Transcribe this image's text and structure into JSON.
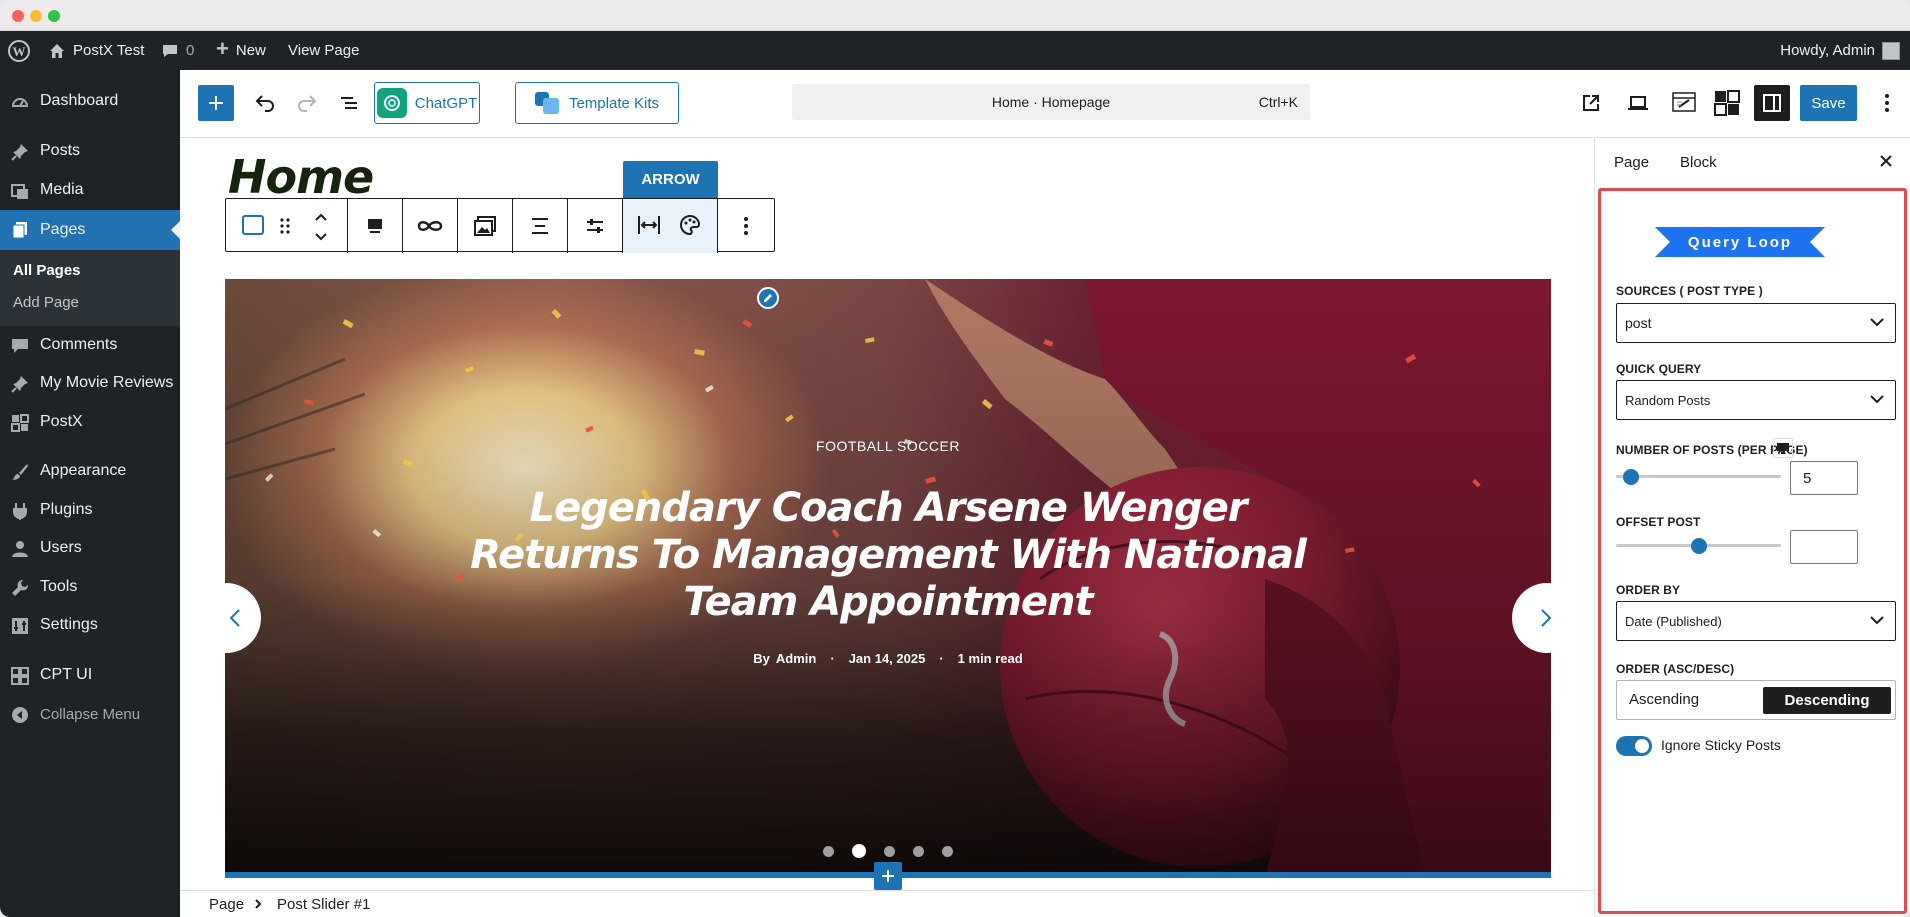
{
  "adminbar": {
    "site_name": "PostX Test",
    "comments_count": "0",
    "new_label": "New",
    "view_page_label": "View Page",
    "howdy": "Howdy, Admin"
  },
  "sidebar": {
    "items": [
      {
        "label": "Dashboard",
        "icon": "dashboard-icon"
      },
      {
        "label": "Posts",
        "icon": "pin-icon"
      },
      {
        "label": "Media",
        "icon": "media-icon"
      },
      {
        "label": "Pages",
        "icon": "pages-icon"
      },
      {
        "label": "Comments",
        "icon": "comment-icon"
      },
      {
        "label": "My Movie Reviews",
        "icon": "pin-icon"
      },
      {
        "label": "PostX",
        "icon": "postx-icon"
      },
      {
        "label": "Appearance",
        "icon": "brush-icon"
      },
      {
        "label": "Plugins",
        "icon": "plugin-icon"
      },
      {
        "label": "Users",
        "icon": "users-icon"
      },
      {
        "label": "Tools",
        "icon": "wrench-icon"
      },
      {
        "label": "Settings",
        "icon": "settings-icon"
      },
      {
        "label": "CPT UI",
        "icon": "grid-icon"
      },
      {
        "label": "Collapse Menu",
        "icon": "collapse-icon"
      }
    ],
    "submenu": {
      "all_pages": "All Pages",
      "add_page": "Add Page"
    }
  },
  "topbar": {
    "chatgpt_label": "ChatGPT",
    "template_kits_label": "Template Kits",
    "command_title": "Home · Homepage",
    "command_shortcut": "Ctrl+K",
    "save_label": "Save"
  },
  "canvas": {
    "page_heading": "Home",
    "toolbar_tooltip": "ARROW",
    "slide": {
      "category": "FOOTBALL SOCCER",
      "title_line1": "Legendary Coach Arsene Wenger",
      "title_line2": "Returns To Management With National",
      "title_line3": "Team Appointment",
      "author_prefix": "By",
      "author": "Admin",
      "date": "Jan 14, 2025",
      "read_time": "1 min read",
      "dot_count": 5,
      "active_dot_index": 1
    }
  },
  "footer": {
    "breadcrumb_root": "Page",
    "breadcrumb_current": "Post Slider #1"
  },
  "panel": {
    "tab_page": "Page",
    "tab_block": "Block",
    "banner": "Query Loop",
    "sources_label": "SOURCES ( POST TYPE )",
    "sources_value": "post",
    "quick_query_label": "QUICK QUERY",
    "quick_query_value": "Random Posts",
    "num_posts_label": "NUMBER OF POSTS (PER PAGE)",
    "num_posts_value": "5",
    "num_posts_slider_fraction": 0.09,
    "offset_label": "OFFSET POST",
    "offset_value": "",
    "offset_slider_fraction": 0.5,
    "order_by_label": "ORDER BY",
    "order_by_value": "Date (Published)",
    "order_label": "ORDER (ASC/DESC)",
    "order_asc": "Ascending",
    "order_desc": "Descending",
    "order_selected": "Descending",
    "ignore_sticky_label": "Ignore Sticky Posts",
    "ignore_sticky_on": true
  },
  "colors": {
    "wp_blue": "#2271b1",
    "editor_blue": "#1d73b3",
    "admin_dark": "#1d23272",
    "highlight_red": "#e34a4a"
  }
}
